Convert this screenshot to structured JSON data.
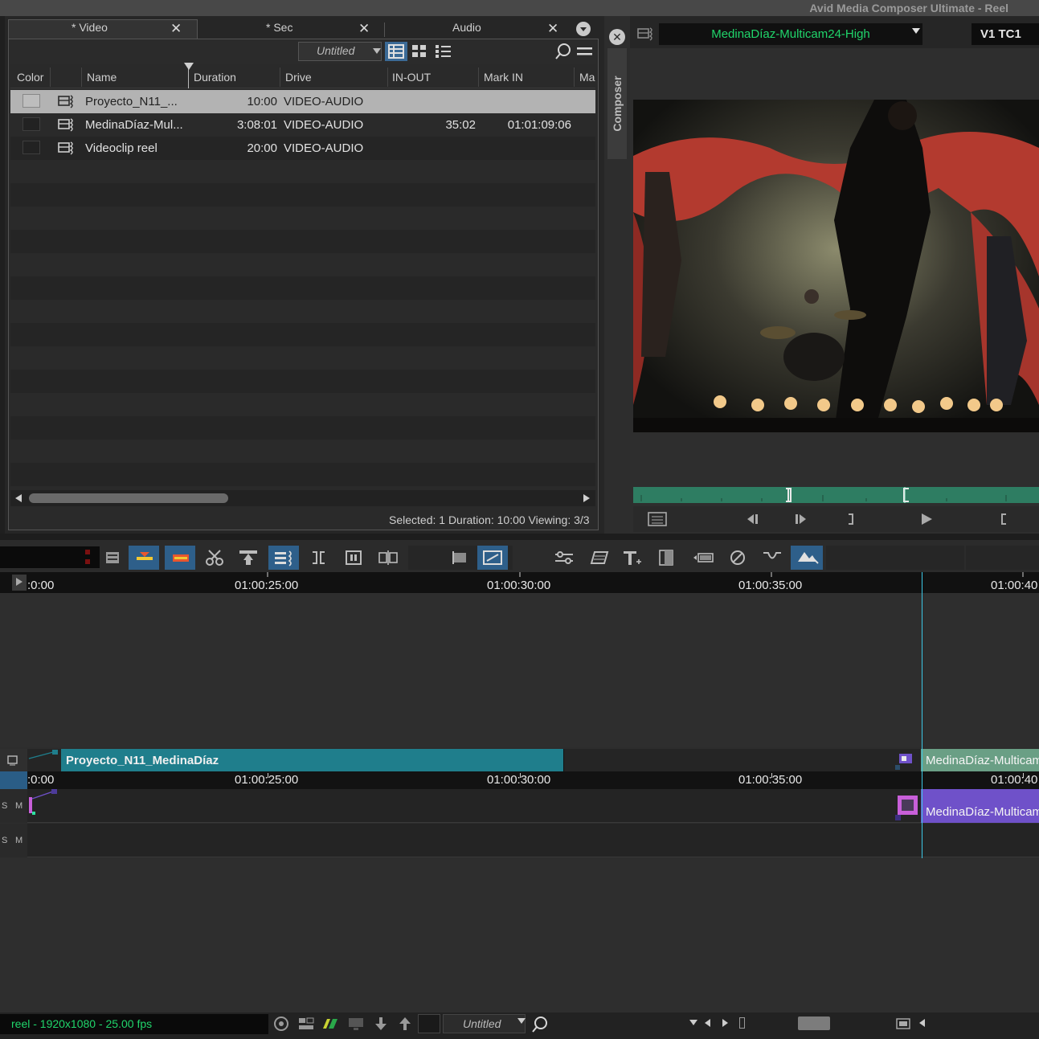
{
  "window": {
    "title": "Avid Media Composer Ultimate - Reel"
  },
  "bin": {
    "tabs": [
      {
        "label": "* Video"
      },
      {
        "label": "* Sec"
      },
      {
        "label": "Audio"
      }
    ],
    "view_name": "Untitled",
    "columns": [
      "Color",
      "Name",
      "Duration",
      "Drive",
      "IN-OUT",
      "Mark IN",
      "Ma"
    ],
    "rows": [
      {
        "name": "Proyecto_N11_...",
        "duration": "10:00",
        "drive": "VIDEO-AUDIO",
        "in_out": "",
        "mark_in": "",
        "selected": true
      },
      {
        "name": "MedinaDíaz-Mul...",
        "duration": "3:08:01",
        "drive": "VIDEO-AUDIO",
        "in_out": "35:02",
        "mark_in": "01:01:09:06",
        "selected": false
      },
      {
        "name": "Videoclip reel",
        "duration": "20:00",
        "drive": "VIDEO-AUDIO",
        "in_out": "",
        "mark_in": "",
        "selected": false
      }
    ],
    "status": "Selected: 1  Duration: 10:00  Viewing: 3/3"
  },
  "composer": {
    "tab_label": "Composer",
    "clip_name": "MedinaDíaz-Multicam24-High",
    "track_label": "V1  TC1"
  },
  "timeline": {
    "ruler_labels": [
      ":0:00",
      "01:00:25:00",
      "01:00:30:00",
      "01:00:35:00",
      "01:00:40"
    ],
    "tc_labels": [
      ":0:00",
      "01:00:25:00",
      "01:00:30:00",
      "01:00:35:00",
      "01:00:40"
    ],
    "v1_clips": [
      {
        "name": "Proyecto_N11_MedinaDíaz",
        "color": "#1f7e8c"
      },
      {
        "name": "MedinaDíaz-Multicam",
        "color": "#6a9f85"
      }
    ],
    "a1_clip": {
      "name": "MedinaDíaz-Multicam",
      "color": "#6f51c9"
    },
    "track_buttons": {
      "s": "S",
      "m": "M"
    }
  },
  "statusbar": {
    "project_info": "reel - 1920x1080 - 25.00 fps",
    "view_name": "Untitled"
  },
  "colors": {
    "accent_green": "#20d56b",
    "playhead": "#3cc8e6",
    "toolbar_blue": "#2e5f8a"
  }
}
